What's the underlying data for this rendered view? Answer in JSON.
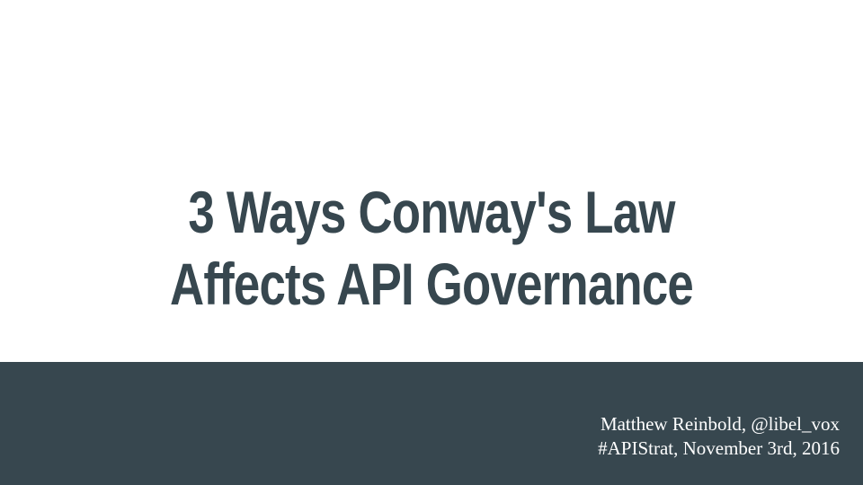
{
  "slide": {
    "title_line_1": "3 Ways Conway's Law",
    "title_line_2": "Affects API Governance",
    "author_line": "Matthew Reinbold, @libel_vox",
    "event_line": "#APIStrat, November 3rd, 2016"
  },
  "colors": {
    "background": "#ffffff",
    "title_text": "#37474f",
    "footer_band": "#37474f",
    "footer_text": "#ffffff"
  }
}
